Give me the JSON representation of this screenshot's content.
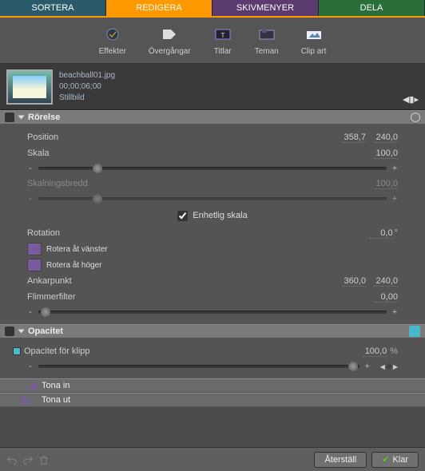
{
  "tabs": {
    "sortera": "SORTERA",
    "redigera": "REDIGERA",
    "skivmenyer": "SKIVMENYER",
    "dela": "DELA"
  },
  "tools": {
    "effekter": "Effekter",
    "overgangar": "Övergångar",
    "titlar": "Titlar",
    "teman": "Teman",
    "clipart": "Clip art"
  },
  "clip": {
    "name": "beachball01.jpg",
    "duration": "00;00;06;00",
    "type": "Stillbild",
    "marker": "◀▮▸"
  },
  "sections": {
    "rorelse": "Rörelse",
    "opacitet": "Opacitet"
  },
  "props": {
    "position": {
      "label": "Position",
      "x": "358,7",
      "y": "240,0"
    },
    "skala": {
      "label": "Skala",
      "value": "100,0"
    },
    "skalbredd": {
      "label": "Skalningsbredd",
      "value": "100,0"
    },
    "enhetlig": "Enhetlig skala",
    "rotation": {
      "label": "Rotation",
      "value": "0,0",
      "unit": "°"
    },
    "rotvanster": "Rotera åt vänster",
    "rothoger": "Rotera åt höger",
    "ankarpunkt": {
      "label": "Ankarpunkt",
      "x": "360,0",
      "y": "240,0"
    },
    "flimmer": {
      "label": "Flimmerfilter",
      "value": "0,00"
    },
    "opacitet_klipp": {
      "label": "Opacitet för klipp",
      "value": "100,0",
      "unit": "%"
    },
    "tona_in": "Tona in",
    "tona_ut": "Tona ut"
  },
  "footer": {
    "aterstall": "Återställ",
    "klar": "Klar"
  }
}
